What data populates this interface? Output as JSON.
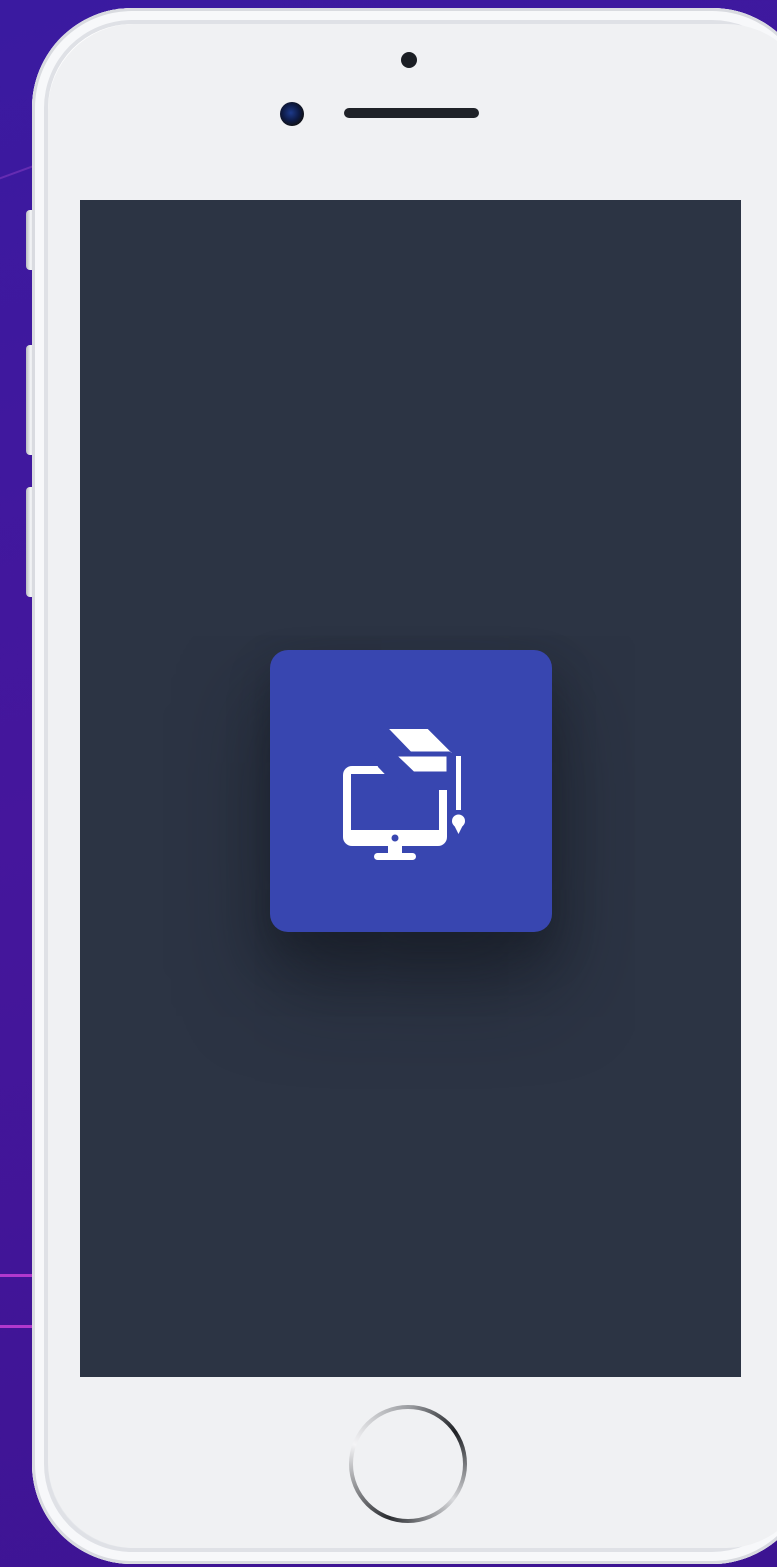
{
  "device": {
    "type": "smartphone-mockup",
    "body_color": "#f0f1f3"
  },
  "screen": {
    "background_color": "#2c3444",
    "app_icon": {
      "icon": "monitor-graduation-cap-icon",
      "tile_color": "#3846b0",
      "glyph_color": "#ffffff"
    }
  },
  "background": {
    "color": "#3f189a",
    "accent_line_color": "#c640d6"
  }
}
